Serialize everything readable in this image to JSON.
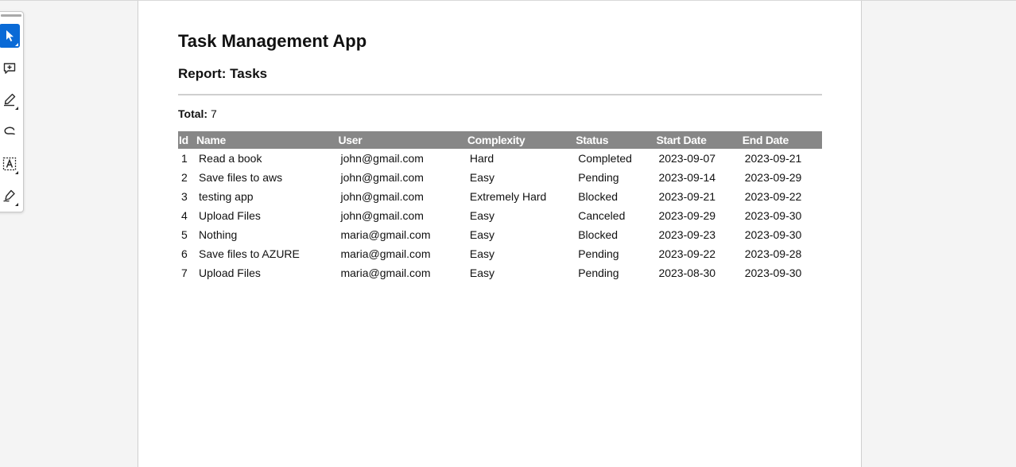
{
  "toolbar": {
    "tools": [
      {
        "icon": "select-arrow-icon",
        "active": true
      },
      {
        "icon": "add-comment-icon",
        "active": false
      },
      {
        "icon": "highlight-pen-icon",
        "active": false
      },
      {
        "icon": "draw-freehand-icon",
        "active": false
      },
      {
        "icon": "text-box-icon",
        "active": false
      },
      {
        "icon": "signature-icon",
        "active": false
      }
    ],
    "accent_color": "#0a6ad6"
  },
  "document": {
    "title": "Task Management App",
    "report_title": "Report: Tasks",
    "total_label": "Total:",
    "total_value": "7",
    "table": {
      "header_color": "#878787",
      "columns": [
        "Id",
        "Name",
        "User",
        "Complexity",
        "Status",
        "Start Date",
        "End Date"
      ],
      "rows": [
        [
          "1",
          "Read a book",
          "john@gmail.com",
          "Hard",
          "Completed",
          "2023-09-07",
          "2023-09-21"
        ],
        [
          "2",
          "Save files to aws",
          "john@gmail.com",
          "Easy",
          "Pending",
          "2023-09-14",
          "2023-09-29"
        ],
        [
          "3",
          "testing app",
          "john@gmail.com",
          "Extremely Hard",
          "Blocked",
          "2023-09-21",
          "2023-09-22"
        ],
        [
          "4",
          "Upload Files",
          "john@gmail.com",
          "Easy",
          "Canceled",
          "2023-09-29",
          "2023-09-30"
        ],
        [
          "5",
          "Nothing",
          "maria@gmail.com",
          "Easy",
          "Blocked",
          "2023-09-23",
          "2023-09-30"
        ],
        [
          "6",
          "Save files to AZURE",
          "maria@gmail.com",
          "Easy",
          "Pending",
          "2023-09-22",
          "2023-09-28"
        ],
        [
          "7",
          "Upload Files",
          "maria@gmail.com",
          "Easy",
          "Pending",
          "2023-08-30",
          "2023-09-30"
        ]
      ]
    }
  }
}
